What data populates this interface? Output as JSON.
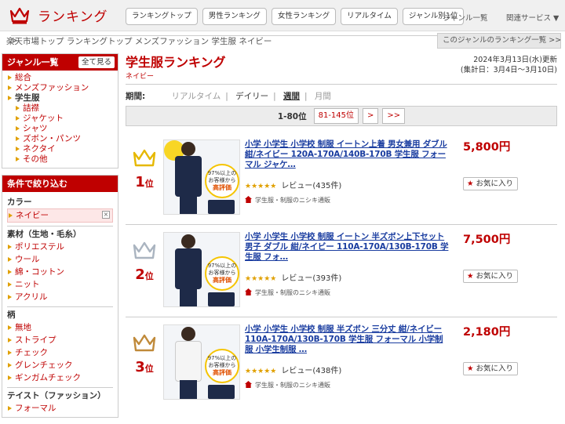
{
  "header": {
    "title": "ランキング",
    "tabs": [
      "ランキングトップ",
      "男性ランキング",
      "女性ランキング",
      "リアルタイム",
      "ジャンル別1位"
    ],
    "genre_list": "ジャンル一覧",
    "related": "関連サービス ▼"
  },
  "breadcrumb": [
    "楽天市場トップ",
    "ランキングトップ",
    "メンズファッション",
    "学生服",
    "ネイビー"
  ],
  "genre_ranking_link": "このジャンルのランキング一覧 >>",
  "sidebar": {
    "genre_title": "ジャンル一覧",
    "show_all": "全て見る",
    "genres": [
      {
        "label": "総合",
        "level": 0
      },
      {
        "label": "メンズファッション",
        "level": 0
      },
      {
        "label": "学生服",
        "level": 0,
        "current": true
      },
      {
        "label": "詰襟",
        "level": 1
      },
      {
        "label": "ジャケット",
        "level": 1
      },
      {
        "label": "シャツ",
        "level": 1
      },
      {
        "label": "ズボン・パンツ",
        "level": 1
      },
      {
        "label": "ネクタイ",
        "level": 1
      },
      {
        "label": "その他",
        "level": 1
      }
    ],
    "filter_title": "条件で絞り込む",
    "color_heading": "カラー",
    "color_selected": "ネイビー",
    "material_heading": "素材（生地・毛糸）",
    "materials": [
      "ポリエステル",
      "ウール",
      "綿・コットン",
      "ニット",
      "アクリル"
    ],
    "pattern_heading": "柄",
    "patterns": [
      "無地",
      "ストライプ",
      "チェック",
      "グレンチェック",
      "ギンガムチェック"
    ],
    "taste_heading": "テイスト（ファッション）",
    "tastes": [
      "フォーマル"
    ]
  },
  "main": {
    "title": "学生服ランキング",
    "subtitle": "ネイビー",
    "updated": "2024年3月13日(水)更新",
    "period_range": "(集計日：3月4日～3月10日)",
    "period_label": "期間:",
    "periods": {
      "realtime": "リアルタイム",
      "daily": "デイリー",
      "weekly": "週間",
      "monthly": "月間"
    },
    "pager": {
      "current": "1-80位",
      "next_range": "81-145位",
      "next": ">",
      "last": ">>"
    },
    "fav_label": "お気に入り",
    "rank_suffix": "位",
    "items": [
      {
        "rank": "1",
        "name": "小学 小学生 小学校 制服 イートン上着 男女兼用 ダブル 紺/ネイビー 120A-170A/140B-170B 学生服 フォーマル ジャケ…",
        "price": "5,800円",
        "review": "レビュー(435件)",
        "shop": "学生服・制服のニシキ通販",
        "crown_color": "#e6b800"
      },
      {
        "rank": "2",
        "name": "小学 小学生 小学校 制服 イートン 半ズボン上下セット 男子 ダブル 紺/ネイビー 110A-170A/130B-170B 学生服 フォ…",
        "price": "7,500円",
        "review": "レビュー(393件)",
        "shop": "学生服・制服のニシキ通販",
        "crown_color": "#aab4c0"
      },
      {
        "rank": "3",
        "name": "小学 小学生 小学校 制服 半ズボン 三分丈 紺/ネイビー 110A-170A/130B-170B 学生服 フォーマル 小学制服 小学生制服 …",
        "price": "2,180円",
        "review": "レビュー(438件)",
        "shop": "学生服・制服のニシキ通販",
        "crown_color": "#c08a3a"
      }
    ],
    "badge_line1": "97%以上の",
    "badge_line2": "お客様から",
    "badge_line3": "高評価",
    "stars": "★★★★★"
  }
}
